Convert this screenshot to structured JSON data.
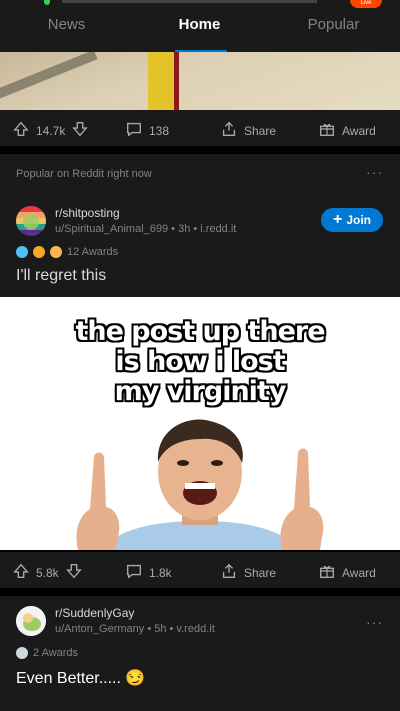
{
  "status": {
    "live_badge": "Live"
  },
  "tabs": {
    "news": "News",
    "home": "Home",
    "popular": "Popular"
  },
  "post1": {
    "upvotes": "14.7k",
    "comments": "138",
    "share": "Share",
    "award": "Award"
  },
  "popular_section": {
    "label": "Popular on Reddit right now",
    "more": "···"
  },
  "post2": {
    "subreddit": "r/shitposting",
    "meta": "u/Spiritual_Animal_699 • 3h • i.redd.it",
    "join": "Join",
    "awards": "12 Awards",
    "title": "I'll regret this",
    "meme_text": [
      "the post up there",
      "is how i lost",
      "my virginity"
    ],
    "upvotes": "5.8k",
    "comments": "1.8k",
    "share": "Share",
    "award": "Award"
  },
  "post3": {
    "subreddit": "r/SuddenlyGay",
    "meta": "u/Anton_Germany • 5h • v.redd.it",
    "awards": "2 Awards",
    "title": "Even Better.....",
    "emoji": "😏",
    "more": "···"
  },
  "colors": {
    "accent": "#0079d3",
    "background": "#000000",
    "surface": "#1a1a1b",
    "live": "#ff4500"
  }
}
